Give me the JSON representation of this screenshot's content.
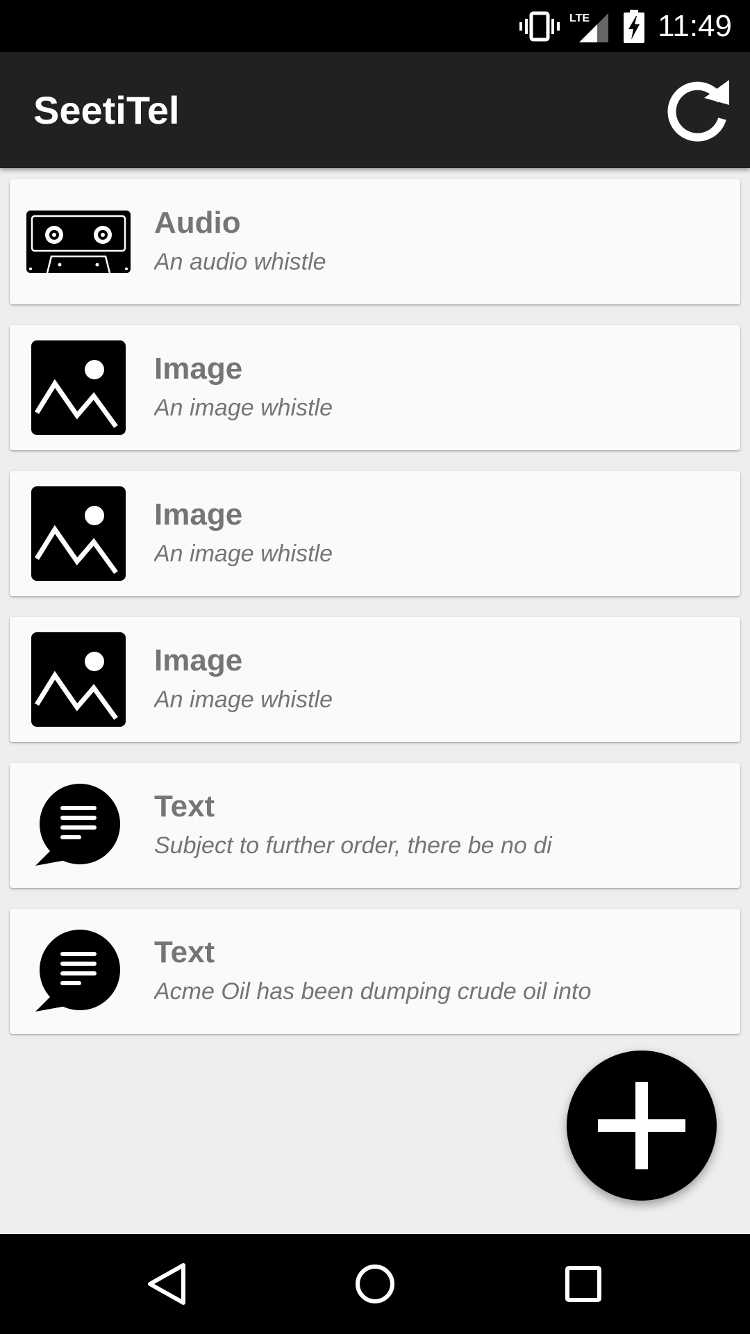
{
  "status_bar": {
    "time": "11:49",
    "network_label": "LTE",
    "icons": [
      "vibrate-icon",
      "lte-signal-icon",
      "battery-charging-icon"
    ]
  },
  "app_bar": {
    "title": "SeetiTel",
    "action_icon": "refresh-icon"
  },
  "items": [
    {
      "type_icon": "cassette-tape-icon",
      "title": "Audio",
      "subtitle": "An audio whistle"
    },
    {
      "type_icon": "image-icon",
      "title": "Image",
      "subtitle": "An image whistle"
    },
    {
      "type_icon": "image-icon",
      "title": "Image",
      "subtitle": "An image whistle"
    },
    {
      "type_icon": "image-icon",
      "title": "Image",
      "subtitle": "An image whistle"
    },
    {
      "type_icon": "chat-bubble-text-icon",
      "title": "Text",
      "subtitle": "Subject to further order, there be no di"
    },
    {
      "type_icon": "chat-bubble-text-icon",
      "title": "Text",
      "subtitle": "Acme Oil has been dumping crude oil into"
    }
  ],
  "fab": {
    "icon": "plus-icon"
  },
  "nav_bar": {
    "icons": [
      "back-icon",
      "home-icon",
      "recents-icon"
    ]
  },
  "colors": {
    "status_bar": "#000000",
    "app_bar": "#212121",
    "background": "#eeeeee",
    "card": "#fafafa",
    "card_text": "#757575",
    "fab": "#000000"
  }
}
